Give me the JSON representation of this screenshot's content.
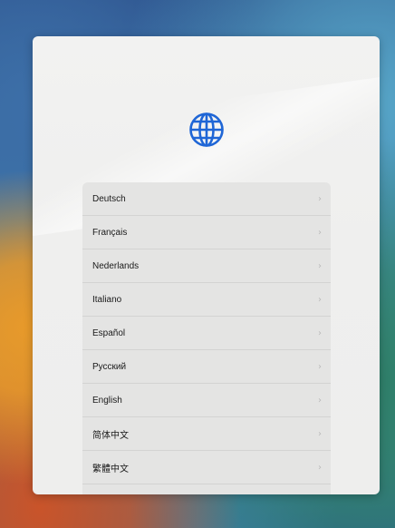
{
  "setup": {
    "icon": "globe-icon",
    "accent_color": "#1f66d6",
    "chevron_glyph": "›",
    "languages": [
      {
        "label": "Deutsch"
      },
      {
        "label": "Français"
      },
      {
        "label": "Nederlands"
      },
      {
        "label": "Italiano"
      },
      {
        "label": "Español"
      },
      {
        "label": "Русский"
      },
      {
        "label": "English"
      },
      {
        "label": "简体中文"
      },
      {
        "label": "繁體中文"
      }
    ]
  }
}
